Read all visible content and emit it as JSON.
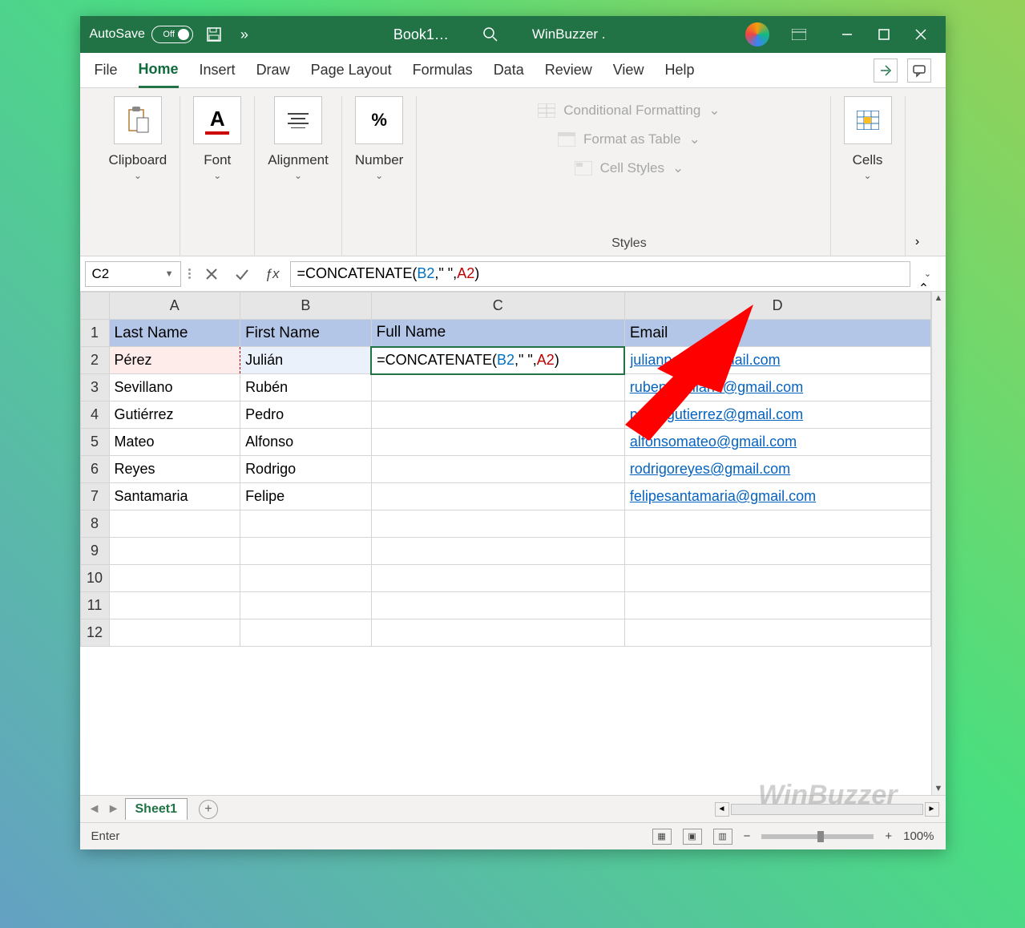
{
  "titlebar": {
    "autosave_label": "AutoSave",
    "autosave_state": "Off",
    "doc_title": "Book1…",
    "user_name": "WinBuzzer ."
  },
  "tabs": {
    "file": "File",
    "home": "Home",
    "insert": "Insert",
    "draw": "Draw",
    "pagelayout": "Page Layout",
    "formulas": "Formulas",
    "data": "Data",
    "review": "Review",
    "view": "View",
    "help": "Help"
  },
  "ribbon": {
    "clipboard": "Clipboard",
    "font": "Font",
    "alignment": "Alignment",
    "number": "Number",
    "cond_format": "Conditional Formatting",
    "format_table": "Format as Table",
    "cell_styles": "Cell Styles",
    "styles": "Styles",
    "cells": "Cells"
  },
  "formula_bar": {
    "name_box": "C2",
    "formula_prefix": "=CONCATENATE(",
    "formula_ref1": "B2",
    "formula_mid": ",\" \",",
    "formula_ref2": "A2",
    "formula_suffix": ")"
  },
  "columns": {
    "A": "A",
    "B": "B",
    "C": "C",
    "D": "D"
  },
  "headers": {
    "A": "Last Name",
    "B": "First Name",
    "C": "Full Name",
    "D": "Email"
  },
  "rows": [
    {
      "n": "1"
    },
    {
      "n": "2",
      "A": "Pérez",
      "B": "Julián",
      "D": "julianperez@gmail.com"
    },
    {
      "n": "3",
      "A": "Sevillano",
      "B": "Rubén",
      "D": "rubensevillano@gmail.com"
    },
    {
      "n": "4",
      "A": "Gutiérrez",
      "B": "Pedro",
      "D": "pedrogutierrez@gmail.com"
    },
    {
      "n": "5",
      "A": "Mateo",
      "B": "Alfonso",
      "D": "alfonsomateo@gmail.com"
    },
    {
      "n": "6",
      "A": "Reyes",
      "B": "Rodrigo",
      "D": "rodrigoreyes@gmail.com"
    },
    {
      "n": "7",
      "A": "Santamaria",
      "B": "Felipe",
      "D": "felipesantamaria@gmail.com"
    },
    {
      "n": "8"
    },
    {
      "n": "9"
    },
    {
      "n": "10"
    },
    {
      "n": "11"
    },
    {
      "n": "12"
    }
  ],
  "cell_formula": {
    "prefix": "=CONCATENATE(",
    "ref1": "B2",
    "mid": ",\" \",",
    "ref2": "A2",
    "suffix": ")"
  },
  "sheet_tab": "Sheet1",
  "status": {
    "mode": "Enter",
    "zoom": "100%"
  },
  "watermark": "WinBuzzer"
}
